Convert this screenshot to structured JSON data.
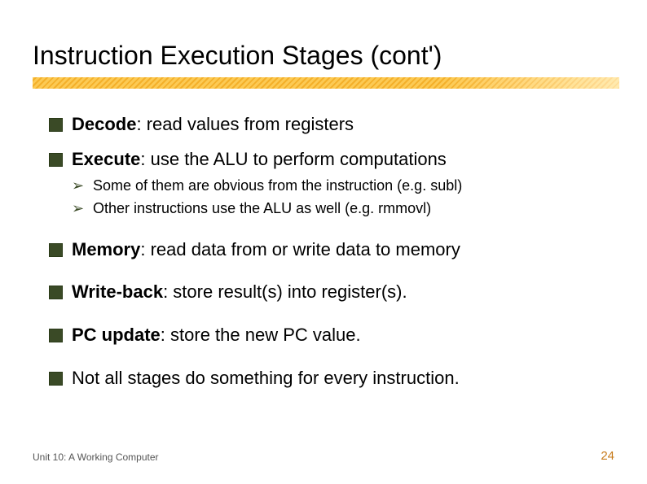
{
  "title": "Instruction Execution Stages (cont')",
  "bullets": {
    "0": {
      "bold": "Decode",
      "rest": ": read values from registers"
    },
    "1": {
      "bold": "Execute",
      "rest": ": use the ALU to perform computations",
      "sub": {
        "0": "Some of them are obvious from the instruction (e.g. subl)",
        "1": "Other instructions use the ALU as well (e.g. rmmovl)"
      }
    },
    "2": {
      "bold": "Memory",
      "rest": ": read data from or write data to memory"
    },
    "3": {
      "bold": "Write-back",
      "rest": ": store result(s) into register(s)."
    },
    "4": {
      "bold": "PC update",
      "rest": ": store the new PC value."
    },
    "5": {
      "text": "Not all stages do something for every instruction."
    }
  },
  "footer": {
    "left": "Unit 10: A Working Computer",
    "right": "24"
  }
}
